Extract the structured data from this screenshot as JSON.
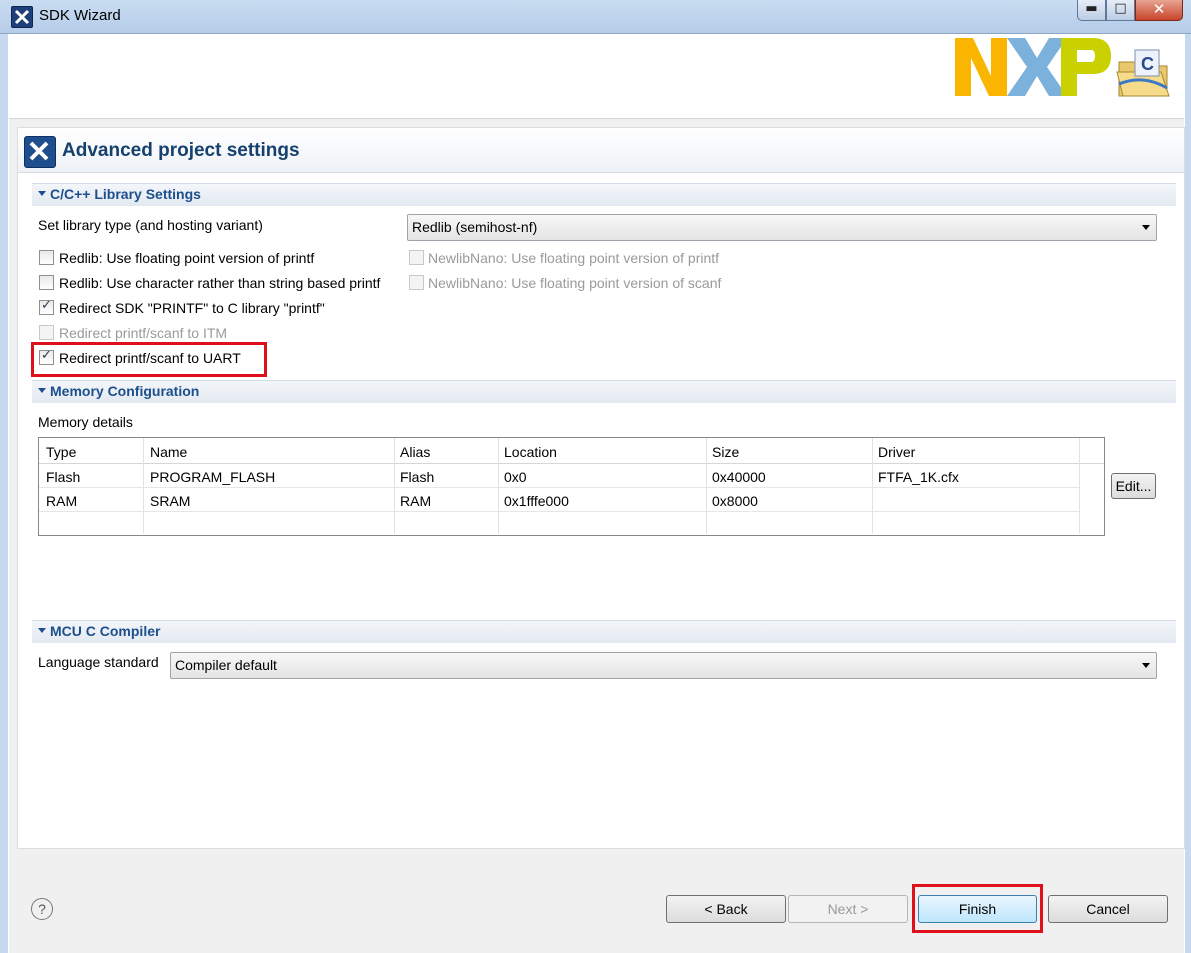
{
  "window": {
    "title": "SDK Wizard",
    "min": "▬",
    "max": "□",
    "close": "✕"
  },
  "header": {
    "title": "Advanced project settings"
  },
  "sections": {
    "library": "C/C++ Library Settings",
    "memory": "Memory Configuration",
    "compiler": "MCU C Compiler"
  },
  "library": {
    "type_label": "Set library type (and hosting variant)",
    "type_value": "Redlib (semihost-nf)",
    "checkboxes": [
      {
        "label": "Redlib: Use floating point version of printf",
        "checked": false,
        "enabled": true
      },
      {
        "label": "Redlib: Use character rather than string based printf",
        "checked": false,
        "enabled": true
      },
      {
        "label": "Redirect SDK \"PRINTF\" to C library \"printf\"",
        "checked": true,
        "enabled": true
      },
      {
        "label": "Redirect printf/scanf to ITM",
        "checked": false,
        "enabled": false
      },
      {
        "label": "Redirect printf/scanf to UART",
        "checked": true,
        "enabled": true
      },
      {
        "label": "NewlibNano: Use floating point version of printf",
        "checked": false,
        "enabled": false
      },
      {
        "label": "NewlibNano: Use floating point version of scanf",
        "checked": false,
        "enabled": false
      }
    ]
  },
  "memory": {
    "details_label": "Memory details",
    "columns": [
      "Type",
      "Name",
      "Alias",
      "Location",
      "Size",
      "Driver"
    ],
    "rows": [
      [
        "Flash",
        "PROGRAM_FLASH",
        "Flash",
        "0x0",
        "0x40000",
        "FTFA_1K.cfx"
      ],
      [
        "RAM",
        "SRAM",
        "RAM",
        "0x1fffe000",
        "0x8000",
        ""
      ]
    ],
    "edit_label": "Edit..."
  },
  "compiler": {
    "language_label": "Language standard",
    "language_value": "Compiler default"
  },
  "footer": {
    "help": "?",
    "back": "< Back",
    "next": "Next >",
    "finish": "Finish",
    "cancel": "Cancel"
  },
  "logo": {
    "text": "NXP",
    "colors": [
      "#f9b500",
      "#7bb1db",
      "#c9d200"
    ]
  },
  "colors": {
    "highlight": "#e0101a",
    "section_title": "#1c4f8c"
  }
}
